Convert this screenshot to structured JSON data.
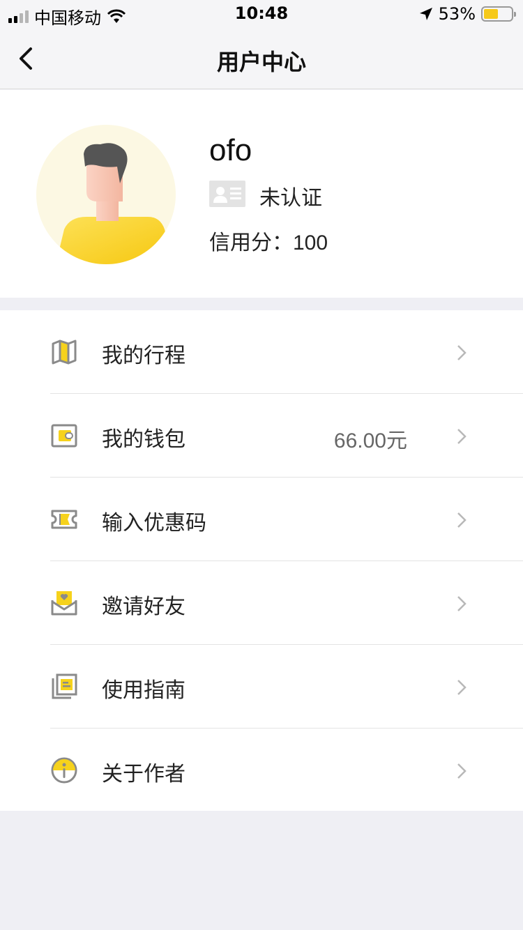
{
  "status_bar": {
    "carrier": "中国移动",
    "time": "10:48",
    "battery_percent": "53%",
    "battery_level": 0.53
  },
  "nav": {
    "title": "用户中心",
    "back_icon": "chevron-left-icon"
  },
  "profile": {
    "username": "ofo",
    "verify_status": "未认证",
    "credit_label": "信用分：",
    "credit_value": "100"
  },
  "menu": {
    "items": [
      {
        "label": "我的行程",
        "icon": "map-icon",
        "value": ""
      },
      {
        "label": "我的钱包",
        "icon": "wallet-icon",
        "value": "66.00元"
      },
      {
        "label": "输入优惠码",
        "icon": "ticket-icon",
        "value": ""
      },
      {
        "label": "邀请好友",
        "icon": "invite-envelope-icon",
        "value": ""
      },
      {
        "label": "使用指南",
        "icon": "guide-icon",
        "value": ""
      },
      {
        "label": "关于作者",
        "icon": "info-icon",
        "value": ""
      }
    ]
  },
  "colors": {
    "accent": "#f6d21c",
    "background": "#efeff4",
    "icon_gray": "#8a8a8a"
  }
}
